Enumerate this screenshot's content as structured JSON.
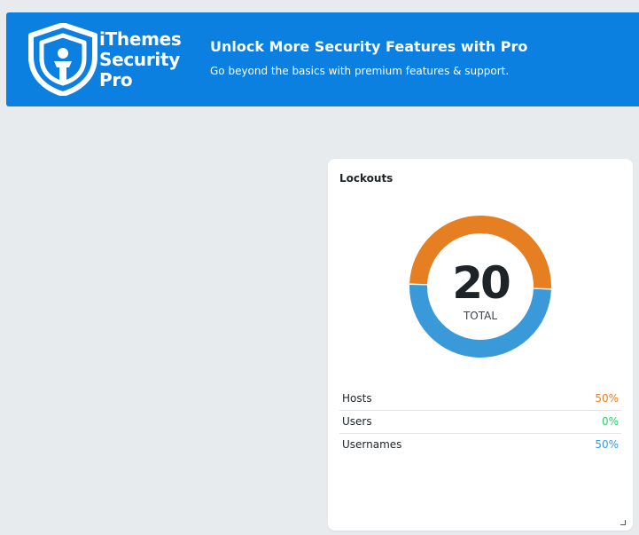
{
  "banner": {
    "logo_line1": "iThemes",
    "logo_line2": "Security",
    "logo_line3": "Pro",
    "headline": "Unlock More Security Features with Pro",
    "subheadline": "Go beyond the basics with premium features & support.",
    "background_color": "#0b80e0"
  },
  "lockouts": {
    "title": "Lockouts",
    "total": "20",
    "total_label": "TOTAL",
    "rows": [
      {
        "label": "Hosts",
        "value": "50%",
        "color": "#e67e22",
        "fraction": 0.5
      },
      {
        "label": "Users",
        "value": "0%",
        "color": "#2ecc71",
        "fraction": 0.0
      },
      {
        "label": "Usernames",
        "value": "50%",
        "color": "#3a9ad9",
        "fraction": 0.5
      }
    ]
  }
}
